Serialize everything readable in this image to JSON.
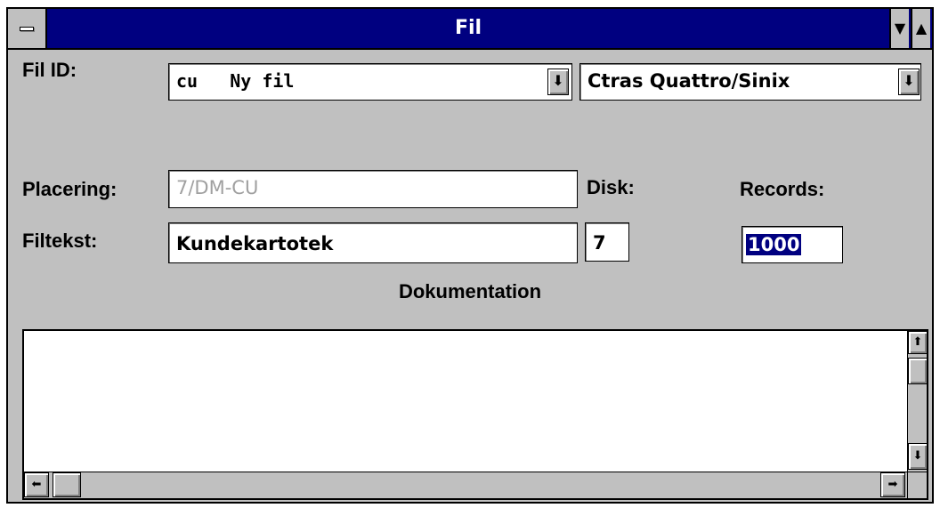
{
  "window": {
    "title": "Fil",
    "icons": {
      "system_menu": "system-menu-icon",
      "minimize": "minimize-icon",
      "maximize": "maximize-icon"
    }
  },
  "form": {
    "fil_id": {
      "label": "Fil ID:",
      "id_value": "cu   Ny fil",
      "type_value": "Ctras Quattro/Sinix"
    },
    "placering": {
      "label": "Placering:",
      "value": "7/DM-CU"
    },
    "filtekst": {
      "label": "Filtekst:",
      "value": "Kundekartotek"
    },
    "disk": {
      "label": "Disk:",
      "value": "7"
    },
    "records": {
      "label": "Records:",
      "value": "1000"
    },
    "dokumentation": {
      "label": "Dokumentation",
      "text": ""
    }
  },
  "icons": {
    "dropdown": "dropdown-arrow-icon",
    "scroll_up": "scroll-up-icon",
    "scroll_down": "scroll-down-icon",
    "scroll_left": "scroll-left-icon",
    "scroll_right": "scroll-right-icon"
  },
  "colors": {
    "title_bar": "#000080",
    "face": "#c0c0c0",
    "selection": "#000080"
  }
}
